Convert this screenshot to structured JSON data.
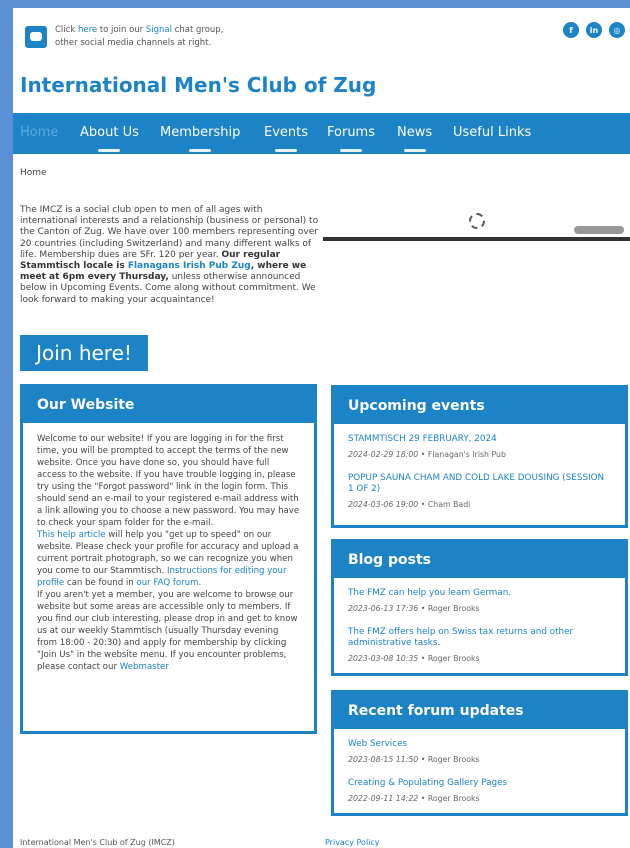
{
  "topbar": {
    "line1_pre": "Click ",
    "line1_here": "here",
    "line1_mid": " to join our ",
    "line1_signal": "Signal",
    "line1_post": " chat group,",
    "line2": "other social media channels at right."
  },
  "social": {
    "facebook": "f",
    "linkedin": "in",
    "instagram": "◎"
  },
  "site_title": "International Men's Club of Zug",
  "nav": {
    "items": [
      {
        "label": "Home"
      },
      {
        "label": "About Us"
      },
      {
        "label": "Membership"
      },
      {
        "label": "Events"
      },
      {
        "label": "Forums"
      },
      {
        "label": "News"
      },
      {
        "label": "Useful Links"
      }
    ]
  },
  "breadcrumb": "Home",
  "intro": {
    "text1": "The IMCZ is a social club open to men of all ages with international interests and a relationship (business or personal) to the Canton of Zug. We have over 100 members representing over 20 countries (including Switzerland) and many different walks of life. Membership dues are SFr. 120 per year. ",
    "bold1": "Our regular Stammtisch locale is ",
    "link": "Flanagans Irish Pub Zug",
    "bold2": ", where we meet at 6pm every Thursday,",
    "text2": " unless otherwise announced below in Upcoming Events. Come along without commitment. We look forward to making your acquaintance!"
  },
  "join_button": "Join here!",
  "our_website": {
    "title": "Our Website",
    "p1": "Welcome to our website!  If you are logging in for the first time, you will be prompted to accept the terms of the new website. Once you have done so, you should have full access to the website.  If you have trouble logging in, please try using the \"Forgot password\" link in the login form.  This should send an e-mail to your registered e-mail address with a link allowing you to choose a new password.  You may have to check your spam folder for the e-mail.",
    "help_link": "This help article",
    "p2": " will help you \"get up to speed\" on our website.  Please check your profile for accuracy and upload a current portrait photograph, so we can recognize you when you come to our Stammtisch.  ",
    "instr_link": "Instructions for editing your profile",
    "p3": " can be found in ",
    "faq_link": "our FAQ forum",
    "p4": ".",
    "p5": "If you aren't yet a member, you are welcome to browse our website but some areas are accessible only to members. If you find our club interesting, please drop in and get to know us at our weekly Stammtisch (usually Thursday evening from 18:00 - 20:30) and apply for membership by clicking \"Join Us\" in the website menu.  If you encounter problems, please contact our ",
    "webmaster_link": "Webmaster"
  },
  "upcoming_events": {
    "title": "Upcoming events",
    "items": [
      {
        "title": "STAMMTISCH 29 FEBRUARY, 2024",
        "date": "2024-02-29 18:00",
        "place": "Flanagan's Irish Pub"
      },
      {
        "title": "POPUP SAUNA CHAM AND COLD LAKE DOUSING (SESSION 1 OF 2)",
        "date": "2024-03-06 19:00",
        "place": "Cham Badi"
      }
    ]
  },
  "blog_posts": {
    "title": "Blog posts",
    "items": [
      {
        "title": "The FMZ can help you learn German.",
        "date": "2023-06-13 17:36",
        "author": "Roger Brooks"
      },
      {
        "title": "The FMZ offers help on Swiss tax returns and other administrative tasks.",
        "date": "2023-03-08 10:35",
        "author": "Roger Brooks"
      }
    ]
  },
  "forum_updates": {
    "title": "Recent forum updates",
    "items": [
      {
        "title": "Web Services",
        "date": "2023-08-15 11:50",
        "author": "Roger Brooks"
      },
      {
        "title": "Creating & Populating Gallery Pages",
        "date": "2022-09-11 14:22",
        "author": "Roger Brooks"
      }
    ]
  },
  "footer": {
    "left": "International Men's Club of Zug (IMCZ)",
    "right": "Privacy Policy"
  },
  "colors": {
    "accent": "#1b83c6",
    "frame": "#5b8fd6"
  }
}
